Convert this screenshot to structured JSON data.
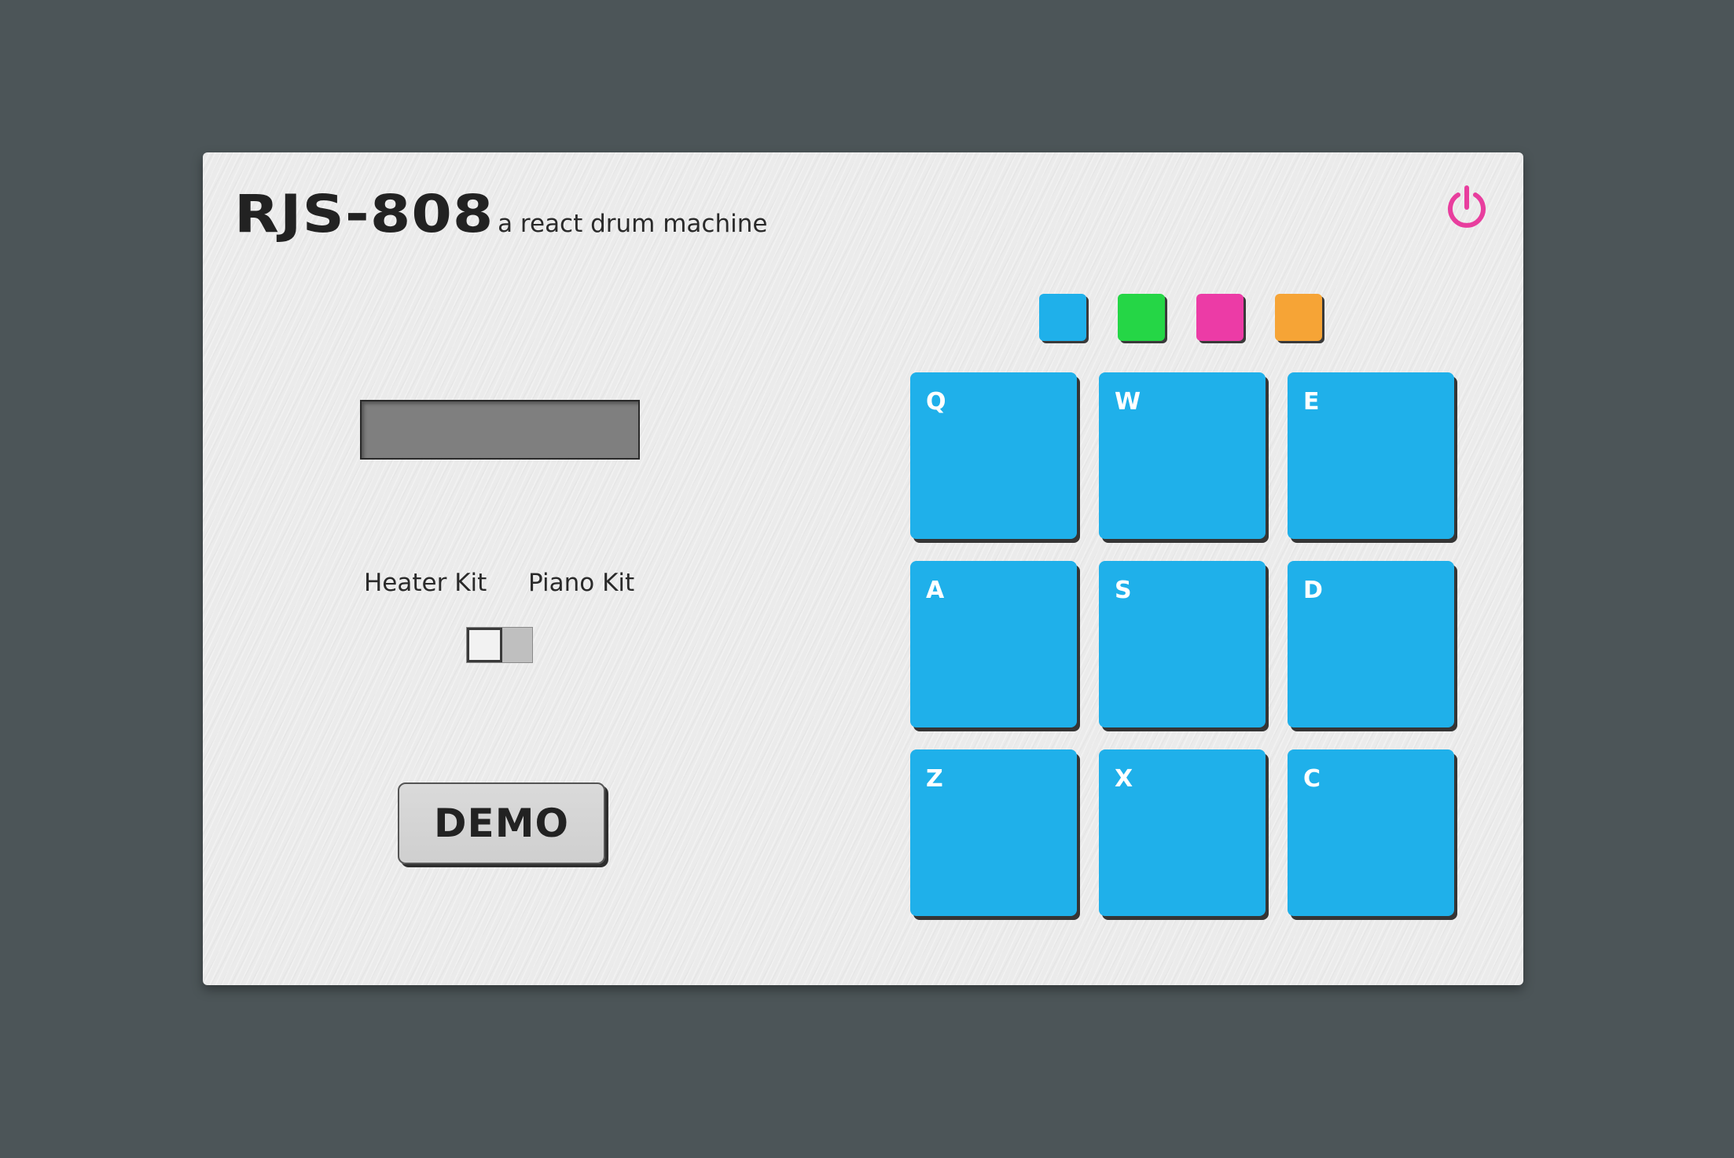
{
  "header": {
    "title": "RJS-808",
    "subtitle": "a react drum machine"
  },
  "power": {
    "icon": "power-icon",
    "color": "#e83e9e"
  },
  "display": {
    "text": ""
  },
  "kit_selector": {
    "left_label": "Heater Kit",
    "right_label": "Piano Kit",
    "selected": "Heater Kit"
  },
  "demo": {
    "label": "DEMO"
  },
  "color_swatches": [
    {
      "name": "blue",
      "color": "#1fb0ea"
    },
    {
      "name": "green",
      "color": "#25d646"
    },
    {
      "name": "pink",
      "color": "#ec3ba6"
    },
    {
      "name": "orange",
      "color": "#f6a436"
    }
  ],
  "pads": [
    {
      "key": "Q"
    },
    {
      "key": "W"
    },
    {
      "key": "E"
    },
    {
      "key": "A"
    },
    {
      "key": "S"
    },
    {
      "key": "D"
    },
    {
      "key": "Z"
    },
    {
      "key": "X"
    },
    {
      "key": "C"
    }
  ],
  "pad_color": "#1fb0ea"
}
